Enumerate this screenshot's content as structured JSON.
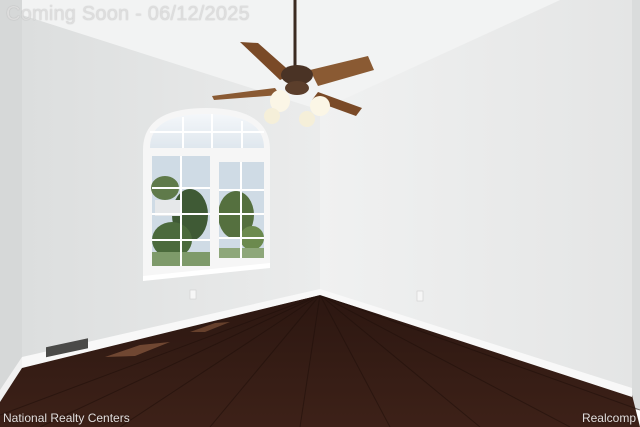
{
  "photo": {
    "subject": "empty bedroom with arched window, ceiling fan and dark hardwood floor",
    "colors": {
      "wall": "#e9eaea",
      "ceiling": "#f1f2f2",
      "floor": "#3a1e16",
      "trim": "#f7f7f7",
      "fan_blade": "#8a5a33"
    }
  },
  "overlays": {
    "banner": "Coming Soon - 06/12/2025",
    "watermark_left": "National Realty Centers",
    "watermark_right": "Realcomp"
  }
}
